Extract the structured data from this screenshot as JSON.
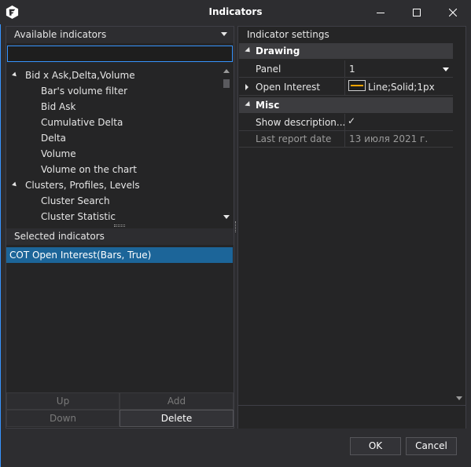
{
  "window": {
    "title": "Indicators",
    "controls": [
      "minimize-icon",
      "maximize-icon",
      "close-icon"
    ]
  },
  "available": {
    "header": "Available indicators",
    "search_value": "",
    "tree": [
      {
        "type": "category",
        "label": "Bid x Ask,Delta,Volume",
        "expanded": true
      },
      {
        "type": "item",
        "label": "Bar's volume filter"
      },
      {
        "type": "item",
        "label": "Bid Ask"
      },
      {
        "type": "item",
        "label": "Cumulative Delta"
      },
      {
        "type": "item",
        "label": "Delta"
      },
      {
        "type": "item",
        "label": "Volume"
      },
      {
        "type": "item",
        "label": "Volume on the chart"
      },
      {
        "type": "category",
        "label": "Clusters, Profiles, Levels",
        "expanded": true
      },
      {
        "type": "item",
        "label": "Cluster Search"
      },
      {
        "type": "item",
        "label": "Cluster Statistic"
      }
    ]
  },
  "selected": {
    "header": "Selected indicators",
    "items": [
      "COT Open Interest(Bars, True)"
    ]
  },
  "list_buttons": {
    "up": "Up",
    "add": "Add",
    "down": "Down",
    "delete": "Delete"
  },
  "settings": {
    "header": "Indicator settings",
    "categories": [
      {
        "label": "Drawing"
      },
      {
        "label": "Misc"
      }
    ],
    "rows": {
      "panel": {
        "name": "Panel",
        "value": "1"
      },
      "open_interest": {
        "name": "Open Interest",
        "value": "Line;Solid;1px"
      },
      "show_description": {
        "name": "Show description...",
        "value": "✓",
        "checked": true
      },
      "last_report_date": {
        "name": "Last report date",
        "value": "13 июля 2021 г."
      }
    }
  },
  "footer": {
    "ok": "OK",
    "cancel": "Cancel"
  },
  "colors": {
    "accent": "#3794ff",
    "selection": "#1c6599",
    "line_color": "#f5a300"
  }
}
